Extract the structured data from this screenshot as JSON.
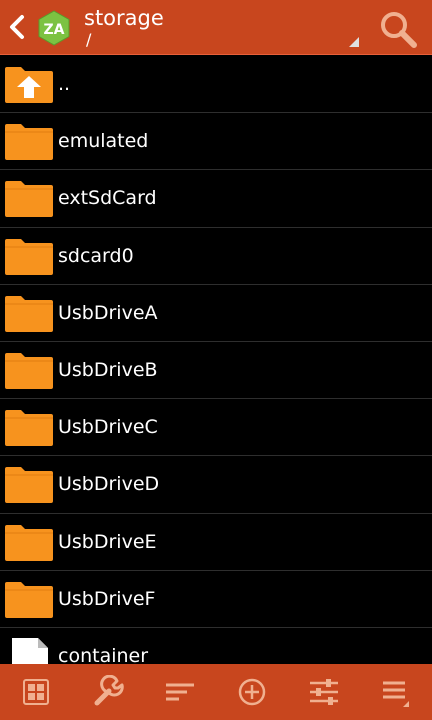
{
  "header": {
    "title": "storage",
    "path": "/",
    "icons": {
      "back": "back-icon",
      "logo": "zarchiver-logo",
      "dropdown": "dropdown-corner-icon",
      "search": "search-icon"
    }
  },
  "files": [
    {
      "name": "..",
      "type": "parent-folder"
    },
    {
      "name": "emulated",
      "type": "folder"
    },
    {
      "name": "extSdCard",
      "type": "folder"
    },
    {
      "name": "sdcard0",
      "type": "folder"
    },
    {
      "name": "UsbDriveA",
      "type": "folder"
    },
    {
      "name": "UsbDriveB",
      "type": "folder"
    },
    {
      "name": "UsbDriveC",
      "type": "folder"
    },
    {
      "name": "UsbDriveD",
      "type": "folder"
    },
    {
      "name": "UsbDriveE",
      "type": "folder"
    },
    {
      "name": "UsbDriveF",
      "type": "folder"
    },
    {
      "name": "container",
      "type": "file"
    }
  ],
  "toolbar": [
    "grid-select-icon",
    "wrench-icon",
    "sort-icon",
    "add-icon",
    "settings-sliders-icon",
    "menu-icon"
  ],
  "colors": {
    "accent": "#c8461e",
    "folder": "#f7931e",
    "background": "#000000"
  }
}
